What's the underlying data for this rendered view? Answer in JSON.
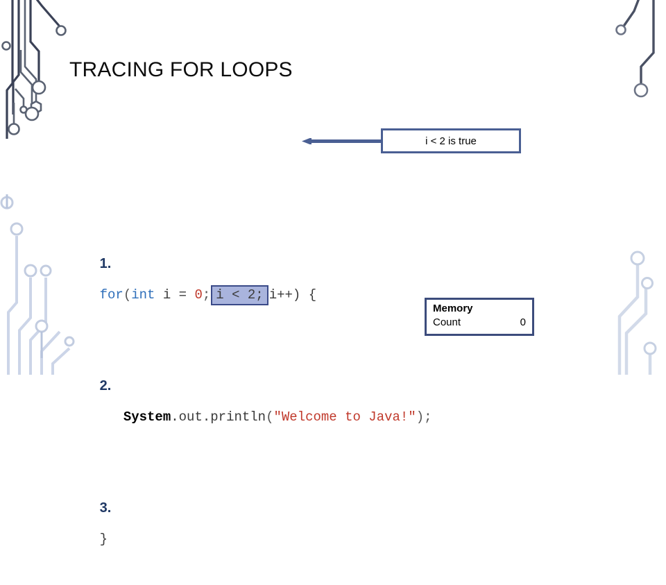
{
  "slide": {
    "title": "TRACING FOR LOOPS"
  },
  "code": {
    "lines": [
      {
        "number": "1.",
        "tokens": [
          {
            "text": "for",
            "kind": "kw"
          },
          {
            "text": "(",
            "kind": "punct"
          },
          {
            "text": "int",
            "kind": "kw"
          },
          {
            "text": " i = ",
            "kind": "plain"
          },
          {
            "text": "0",
            "kind": "num"
          },
          {
            "text": ";",
            "kind": "punct"
          }
        ],
        "highlight": "i < 2;",
        "highlight_num": "2",
        "tail": "i++) {"
      },
      {
        "number": "2.",
        "tokens": [
          {
            "text": "   ",
            "kind": "plain"
          },
          {
            "text": "System",
            "kind": "bold"
          },
          {
            "text": ".out.println",
            "kind": "plain"
          },
          {
            "text": "(",
            "kind": "punct"
          },
          {
            "text": "\"Welcome to Java!\"",
            "kind": "str"
          },
          {
            "text": ")",
            "kind": "punct"
          },
          {
            "text": ";",
            "kind": "punct"
          }
        ]
      },
      {
        "number": "3.",
        "tokens": [
          {
            "text": "}",
            "kind": "plain"
          }
        ]
      }
    ]
  },
  "callout": {
    "text": "i < 2 is true"
  },
  "memory": {
    "title": "Memory",
    "rows": [
      {
        "name": "Count",
        "value": "0"
      }
    ]
  },
  "colors": {
    "highlight_fill": "#a9b4dd",
    "highlight_border": "#3a4a88",
    "callout_border": "#4a5f93",
    "memory_border": "#3c4c7c",
    "keyword": "#2f6fba",
    "string": "#c0392b",
    "number": "#c0392b",
    "lineno": "#1f3864",
    "arrow": "#4a5f93"
  }
}
